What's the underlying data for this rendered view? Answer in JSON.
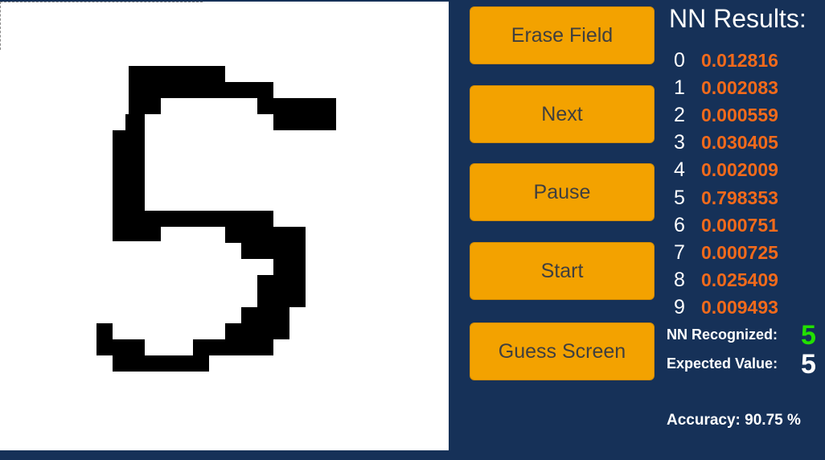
{
  "buttons": {
    "erase_field": "Erase Field",
    "next": "Next",
    "pause": "Pause",
    "start": "Start",
    "guess_screen": "Guess Screen"
  },
  "results": {
    "title": "NN Results:",
    "rows": [
      {
        "digit": "0",
        "prob": "0.012816"
      },
      {
        "digit": "1",
        "prob": "0.002083"
      },
      {
        "digit": "2",
        "prob": "0.000559"
      },
      {
        "digit": "3",
        "prob": "0.030405"
      },
      {
        "digit": "4",
        "prob": "0.002009"
      },
      {
        "digit": "5",
        "prob": "0.798353"
      },
      {
        "digit": "6",
        "prob": "0.000751"
      },
      {
        "digit": "7",
        "prob": "0.000725"
      },
      {
        "digit": "8",
        "prob": "0.025409"
      },
      {
        "digit": "9",
        "prob": "0.009493"
      }
    ]
  },
  "summary": {
    "recognized_label": "NN Recognized:",
    "recognized_value": "5",
    "expected_label": "Expected Value:",
    "expected_value": "5",
    "accuracy": "Accuracy: 90.75 %"
  },
  "colors": {
    "background": "#163158",
    "button": "#f3a200",
    "probability": "#f26a1b",
    "recognized": "#22e000",
    "expected": "#ffffff",
    "ink": "#000000"
  }
}
